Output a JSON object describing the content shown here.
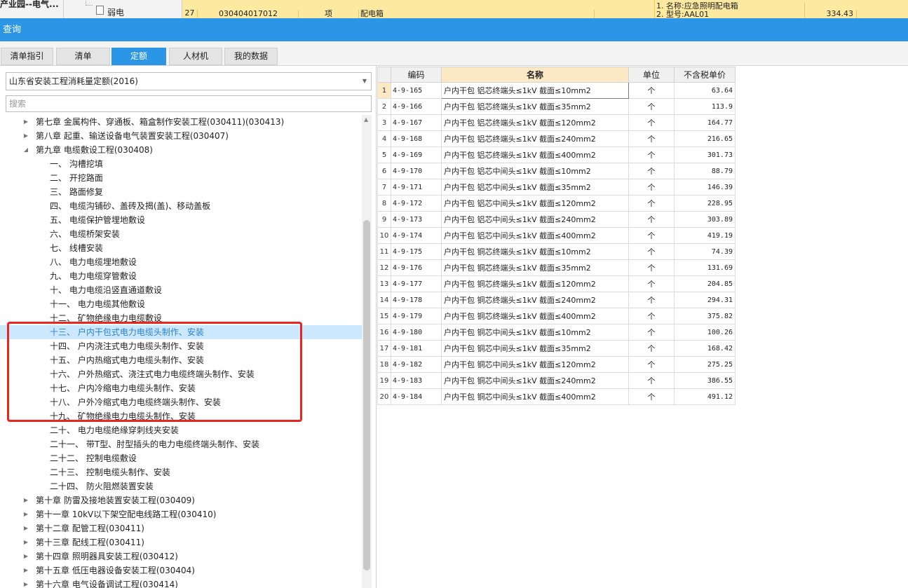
{
  "top_strip": {
    "project": "产业园--电气...",
    "tree_item": "弱电",
    "row_number": "27",
    "code": "030404017012",
    "type": "项",
    "name": "配电箱",
    "feature_line1": "1. 名称:应急照明配电箱",
    "feature_line2": "2. 型号:AAL01",
    "amount": "334.43"
  },
  "window": {
    "title": "查询"
  },
  "tabs": [
    {
      "label": "清单指引",
      "active": false
    },
    {
      "label": "清单",
      "active": false
    },
    {
      "label": "定额",
      "active": true
    },
    {
      "label": "人材机",
      "active": false
    },
    {
      "label": "我的数据",
      "active": false
    }
  ],
  "quota_selector": {
    "value": "山东省安装工程消耗量定额(2016)"
  },
  "search": {
    "placeholder": "搜索"
  },
  "tree": [
    {
      "label": "第七章 金属构件、穿通板、箱盒制作安装工程(030411)(030413)",
      "level": 0,
      "expanded": false,
      "selected": false
    },
    {
      "label": "第八章 起重、输送设备电气装置安装工程(030407)",
      "level": 0,
      "expanded": false,
      "selected": false
    },
    {
      "label": "第九章 电缆敷设工程(030408)",
      "level": 0,
      "expanded": true,
      "selected": false
    },
    {
      "label": "一、 沟槽挖填",
      "level": 1,
      "selected": false
    },
    {
      "label": "二、 开挖路面",
      "level": 1,
      "selected": false
    },
    {
      "label": "三、 路面修复",
      "level": 1,
      "selected": false
    },
    {
      "label": "四、 电缆沟铺砂、盖砖及揭(盖)、移动盖板",
      "level": 1,
      "selected": false
    },
    {
      "label": "五、 电缆保护管埋地敷设",
      "level": 1,
      "selected": false
    },
    {
      "label": "六、 电缆桥架安装",
      "level": 1,
      "selected": false
    },
    {
      "label": "七、 线槽安装",
      "level": 1,
      "selected": false
    },
    {
      "label": "八、 电力电缆埋地敷设",
      "level": 1,
      "selected": false
    },
    {
      "label": "九、 电力电缆穿管敷设",
      "level": 1,
      "selected": false
    },
    {
      "label": "十、 电力电缆沿竖直通道敷设",
      "level": 1,
      "selected": false
    },
    {
      "label": "十一、 电力电缆其他敷设",
      "level": 1,
      "selected": false
    },
    {
      "label": "十二、 矿物绝缘电力电缆敷设",
      "level": 1,
      "selected": false
    },
    {
      "label": "十三、 户内干包式电力电缆头制作、安装",
      "level": 1,
      "selected": true
    },
    {
      "label": "十四、 户内浇注式电力电缆头制作、安装",
      "level": 1,
      "selected": false
    },
    {
      "label": "十五、 户内热缩式电力电缆头制作、安装",
      "level": 1,
      "selected": false
    },
    {
      "label": "十六、 户外热缩式、浇注式电力电缆终端头制作、安装",
      "level": 1,
      "selected": false
    },
    {
      "label": "十七、 户内冷缩电力电缆头制作、安装",
      "level": 1,
      "selected": false
    },
    {
      "label": "十八、 户外冷缩式电力电缆终端头制作、安装",
      "level": 1,
      "selected": false
    },
    {
      "label": "十九、 矿物绝缘电力电缆头制作、安装",
      "level": 1,
      "selected": false
    },
    {
      "label": "二十、 电力电缆绝缘穿刺线夹安装",
      "level": 1,
      "selected": false
    },
    {
      "label": "二十一、 带T型、肘型插头的电力电缆终端头制作、安装",
      "level": 1,
      "selected": false
    },
    {
      "label": "二十二、 控制电缆敷设",
      "level": 1,
      "selected": false
    },
    {
      "label": "二十三、 控制电缆头制作、安装",
      "level": 1,
      "selected": false
    },
    {
      "label": "二十四、 防火阻燃装置安装",
      "level": 1,
      "selected": false
    },
    {
      "label": "第十章 防雷及接地装置安装工程(030409)",
      "level": 0,
      "expanded": false,
      "selected": false
    },
    {
      "label": "第十一章 10kV以下架空配电线路工程(030410)",
      "level": 0,
      "expanded": false,
      "selected": false
    },
    {
      "label": "第十二章 配管工程(030411)",
      "level": 0,
      "expanded": false,
      "selected": false
    },
    {
      "label": "第十三章 配线工程(030411)",
      "level": 0,
      "expanded": false,
      "selected": false
    },
    {
      "label": "第十四章 照明器具安装工程(030412)",
      "level": 0,
      "expanded": false,
      "selected": false
    },
    {
      "label": "第十五章 低压电器设备安装工程(030404)",
      "level": 0,
      "expanded": false,
      "selected": false
    },
    {
      "label": "第十六章 电气设备调试工程(030414)",
      "level": 0,
      "expanded": false,
      "selected": false
    }
  ],
  "grid": {
    "columns": [
      "编码",
      "名称",
      "单位",
      "不含税单价"
    ],
    "rows": [
      {
        "n": "1",
        "code": "4-9-165",
        "name": "户内干包 铝芯终端头≤1kV 截面≤10mm2",
        "unit": "个",
        "price": "63.64"
      },
      {
        "n": "2",
        "code": "4-9-166",
        "name": "户内干包 铝芯终端头≤1kV 截面≤35mm2",
        "unit": "个",
        "price": "113.9"
      },
      {
        "n": "3",
        "code": "4-9-167",
        "name": "户内干包 铝芯终端头≤1kV 截面≤120mm2",
        "unit": "个",
        "price": "164.77"
      },
      {
        "n": "4",
        "code": "4-9-168",
        "name": "户内干包 铝芯终端头≤1kV 截面≤240mm2",
        "unit": "个",
        "price": "216.65"
      },
      {
        "n": "5",
        "code": "4-9-169",
        "name": "户内干包 铝芯终端头≤1kV 截面≤400mm2",
        "unit": "个",
        "price": "301.73"
      },
      {
        "n": "6",
        "code": "4-9-170",
        "name": "户内干包 铝芯中间头≤1kV 截面≤10mm2",
        "unit": "个",
        "price": "88.79"
      },
      {
        "n": "7",
        "code": "4-9-171",
        "name": "户内干包 铝芯中间头≤1kV 截面≤35mm2",
        "unit": "个",
        "price": "146.39"
      },
      {
        "n": "8",
        "code": "4-9-172",
        "name": "户内干包 铝芯中间头≤1kV 截面≤120mm2",
        "unit": "个",
        "price": "228.95"
      },
      {
        "n": "9",
        "code": "4-9-173",
        "name": "户内干包 铝芯中间头≤1kV 截面≤240mm2",
        "unit": "个",
        "price": "303.89"
      },
      {
        "n": "10",
        "code": "4-9-174",
        "name": "户内干包 铝芯中间头≤1kV 截面≤400mm2",
        "unit": "个",
        "price": "419.19"
      },
      {
        "n": "11",
        "code": "4-9-175",
        "name": "户内干包 铜芯终端头≤1kV 截面≤10mm2",
        "unit": "个",
        "price": "74.39"
      },
      {
        "n": "12",
        "code": "4-9-176",
        "name": "户内干包 铜芯终端头≤1kV 截面≤35mm2",
        "unit": "个",
        "price": "131.69"
      },
      {
        "n": "13",
        "code": "4-9-177",
        "name": "户内干包 铜芯终端头≤1kV 截面≤120mm2",
        "unit": "个",
        "price": "204.85"
      },
      {
        "n": "14",
        "code": "4-9-178",
        "name": "户内干包 铜芯终端头≤1kV 截面≤240mm2",
        "unit": "个",
        "price": "294.31"
      },
      {
        "n": "15",
        "code": "4-9-179",
        "name": "户内干包 铜芯终端头≤1kV 截面≤400mm2",
        "unit": "个",
        "price": "375.82"
      },
      {
        "n": "16",
        "code": "4-9-180",
        "name": "户内干包 铜芯中间头≤1kV 截面≤10mm2",
        "unit": "个",
        "price": "100.26"
      },
      {
        "n": "17",
        "code": "4-9-181",
        "name": "户内干包 铜芯中间头≤1kV 截面≤35mm2",
        "unit": "个",
        "price": "168.42"
      },
      {
        "n": "18",
        "code": "4-9-182",
        "name": "户内干包 铜芯中间头≤1kV 截面≤120mm2",
        "unit": "个",
        "price": "275.25"
      },
      {
        "n": "19",
        "code": "4-9-183",
        "name": "户内干包 铜芯中间头≤1kV 截面≤240mm2",
        "unit": "个",
        "price": "386.55"
      },
      {
        "n": "20",
        "code": "4-9-184",
        "name": "户内干包 铜芯中间头≤1kV 截面≤400mm2",
        "unit": "个",
        "price": "491.12"
      }
    ]
  },
  "colors": {
    "accent": "#2b96e6",
    "selected_row": "#cce8ff",
    "highlight_box": "#e8281e",
    "header_name": "#fde8c6",
    "top_strip_row": "#fde9a0"
  },
  "icons": {
    "tree_expand": "caret-right-icon",
    "tree_collapse": "caret-down-icon",
    "combo_arrow": "chevron-down-icon",
    "tree_item": "document-icon"
  }
}
